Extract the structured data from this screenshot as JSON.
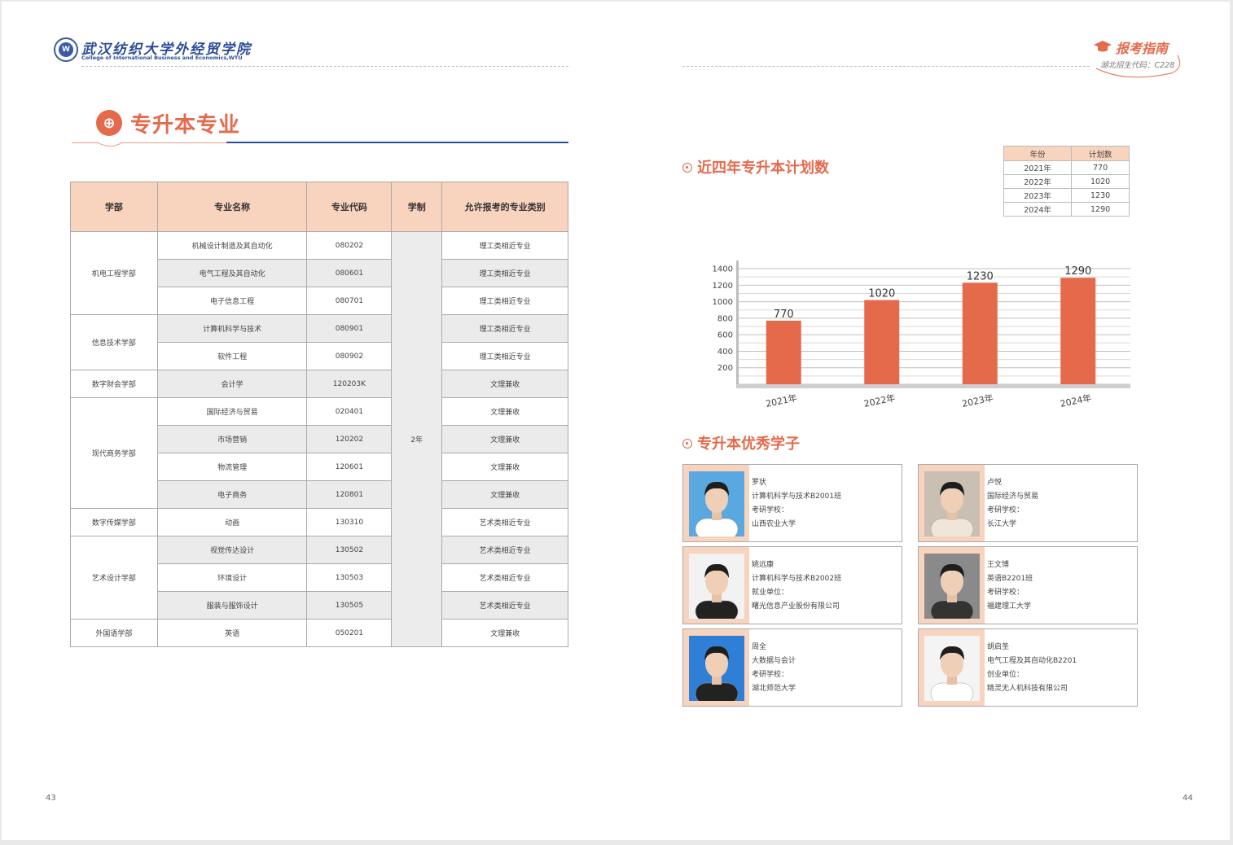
{
  "header": {
    "college_cn": "武汉纺织大学外经贸学院",
    "college_en": "College of International Business and Economics,WTU",
    "badge_title": "报考指南",
    "badge_code": "湖北招生代码：C228"
  },
  "left_page": {
    "section_title": "专升本专业",
    "page_number": "43"
  },
  "table": {
    "headers": [
      "学部",
      "专业名称",
      "专业代码",
      "学制",
      "允许报考的专业类别"
    ],
    "duration": "2年",
    "departments": [
      {
        "name": "机电工程学部",
        "rows": [
          {
            "major": "机械设计制造及其自动化",
            "code": "080202",
            "category": "理工类相近专业"
          },
          {
            "major": "电气工程及其自动化",
            "code": "080601",
            "category": "理工类相近专业"
          },
          {
            "major": "电子信息工程",
            "code": "080701",
            "category": "理工类相近专业"
          }
        ]
      },
      {
        "name": "信息技术学部",
        "rows": [
          {
            "major": "计算机科学与技术",
            "code": "080901",
            "category": "理工类相近专业"
          },
          {
            "major": "软件工程",
            "code": "080902",
            "category": "理工类相近专业"
          }
        ]
      },
      {
        "name": "数字财会学部",
        "rows": [
          {
            "major": "会计学",
            "code": "120203K",
            "category": "文理兼收"
          }
        ]
      },
      {
        "name": "现代商务学部",
        "rows": [
          {
            "major": "国际经济与贸易",
            "code": "020401",
            "category": "文理兼收"
          },
          {
            "major": "市场营销",
            "code": "120202",
            "category": "文理兼收"
          },
          {
            "major": "物流管理",
            "code": "120601",
            "category": "文理兼收"
          },
          {
            "major": "电子商务",
            "code": "120801",
            "category": "文理兼收"
          }
        ]
      },
      {
        "name": "数字传媒学部",
        "rows": [
          {
            "major": "动画",
            "code": "130310",
            "category": "艺术类相近专业"
          }
        ]
      },
      {
        "name": "艺术设计学部",
        "rows": [
          {
            "major": "视觉传达设计",
            "code": "130502",
            "category": "艺术类相近专业"
          },
          {
            "major": "环境设计",
            "code": "130503",
            "category": "艺术类相近专业"
          },
          {
            "major": "服装与服饰设计",
            "code": "130505",
            "category": "艺术类相近专业"
          }
        ]
      },
      {
        "name": "外国语学部",
        "rows": [
          {
            "major": "英语",
            "code": "050201",
            "category": "文理兼收"
          }
        ]
      }
    ]
  },
  "right_page": {
    "plan_title": "近四年专升本计划数",
    "students_title": "专升本优秀学子",
    "page_number": "44",
    "plan_table": {
      "headers": [
        "年份",
        "计划数"
      ],
      "rows": [
        [
          "2021年",
          "770"
        ],
        [
          "2022年",
          "1020"
        ],
        [
          "2023年",
          "1230"
        ],
        [
          "2024年",
          "1290"
        ]
      ]
    }
  },
  "chart_data": {
    "type": "bar",
    "categories": [
      "2021年",
      "2022年",
      "2023年",
      "2024年"
    ],
    "values": [
      770,
      1020,
      1230,
      1290
    ],
    "yticks": [
      200,
      400,
      600,
      800,
      1000,
      1200,
      1400
    ],
    "ylim": [
      0,
      1500
    ],
    "bar_color": "#e56a4c",
    "grid": true
  },
  "students": [
    {
      "name": "罗状",
      "class": "计算机科学与技术B2001班",
      "dest_label": "考研学校：",
      "dest": "山西农业大学",
      "bg": "#5aa8e0",
      "shirt": "#ffffff"
    },
    {
      "name": "卢悦",
      "class": "国际经济与贸易",
      "dest_label": "考研学校：",
      "dest": "长江大学",
      "bg": "#c9bfb3",
      "shirt": "#efe6d9"
    },
    {
      "name": "姚远康",
      "class": "计算机科学与技术B2002班",
      "dest_label": "就业单位：",
      "dest": "曙光信息产业股份有限公司",
      "bg": "#f2f2f2",
      "shirt": "#222222"
    },
    {
      "name": "王文博",
      "class": "英语B2201班",
      "dest_label": "考研学校：",
      "dest": "福建理工大学",
      "bg": "#8a8a8a",
      "shirt": "#333333"
    },
    {
      "name": "周全",
      "class": "大数据与会计",
      "dest_label": "考研学校：",
      "dest": "湖北师范大学",
      "bg": "#2f7fd6",
      "shirt": "#222222"
    },
    {
      "name": "胡启圣",
      "class": "电气工程及其自动化B2201",
      "dest_label": "创业单位：",
      "dest": "精灵无人机科技有限公司",
      "bg": "#f4f4f4",
      "shirt": "#ffffff"
    }
  ]
}
